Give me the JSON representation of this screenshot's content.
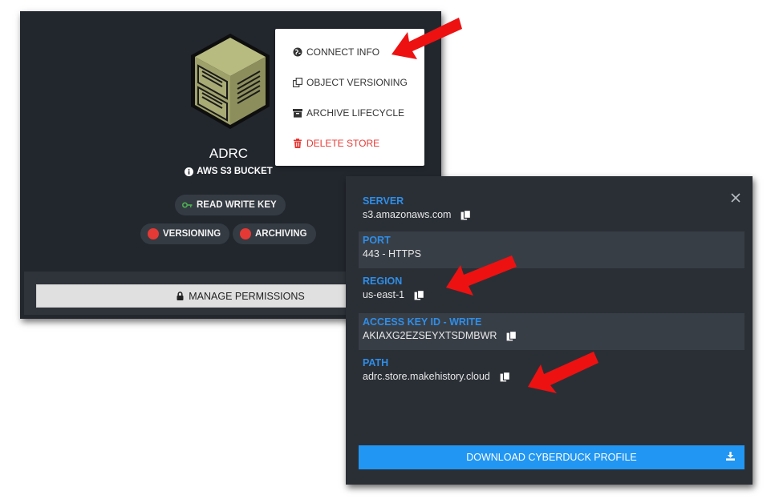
{
  "store": {
    "name": "ADRC",
    "type_label": "AWS S3 BUCKET",
    "key_label": "READ WRITE KEY",
    "badges": [
      "VERSIONING",
      "ARCHIVING"
    ],
    "manage_label": "MANAGE PERMISSIONS"
  },
  "menu": {
    "items": [
      {
        "label": "CONNECT INFO",
        "icon": "globe-icon"
      },
      {
        "label": "OBJECT VERSIONING",
        "icon": "copy-icon"
      },
      {
        "label": "ARCHIVE LIFECYCLE",
        "icon": "archive-icon"
      },
      {
        "label": "DELETE STORE",
        "icon": "trash-icon"
      }
    ]
  },
  "connect": {
    "fields": [
      {
        "label": "SERVER",
        "value": "s3.amazonaws.com",
        "copyable": true
      },
      {
        "label": "PORT",
        "value": "443 - HTTPS",
        "copyable": false
      },
      {
        "label": "REGION",
        "value": "us-east-1",
        "copyable": true
      },
      {
        "label": "ACCESS KEY ID - WRITE",
        "value": "AKIAXG2EZSEYXTSDMBWR",
        "copyable": true
      },
      {
        "label": "PATH",
        "value": "adrc.store.makehistory.cloud",
        "copyable": true
      }
    ],
    "download_label": "DOWNLOAD CYBERDUCK PROFILE"
  },
  "colors": {
    "accent": "#2196f3",
    "label_blue": "#2f8ee8",
    "danger": "#e53935",
    "card_bg": "#22272e",
    "annotation_arrow": "#ee1111"
  }
}
